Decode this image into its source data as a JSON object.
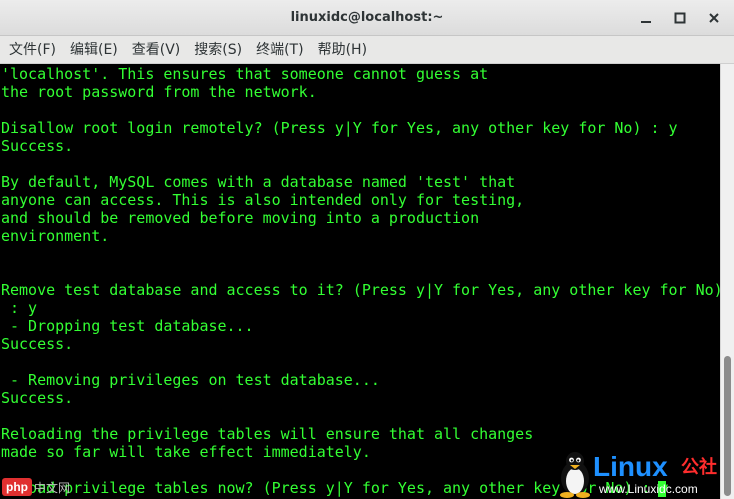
{
  "window": {
    "title": "linuxidc@localhost:~"
  },
  "menu": [
    {
      "label": "文件(F)"
    },
    {
      "label": "编辑(E)"
    },
    {
      "label": "查看(V)"
    },
    {
      "label": "搜索(S)"
    },
    {
      "label": "终端(T)"
    },
    {
      "label": "帮助(H)"
    }
  ],
  "terminal": {
    "text_color": "#33ff33",
    "background": "#000000",
    "lines": [
      "'localhost'. This ensures that someone cannot guess at",
      "the root password from the network.",
      "",
      "Disallow root login remotely? (Press y|Y for Yes, any other key for No) : y",
      "Success.",
      "",
      "By default, MySQL comes with a database named 'test' that",
      "anyone can access. This is also intended only for testing,",
      "and should be removed before moving into a production",
      "environment.",
      "",
      "",
      "Remove test database and access to it? (Press y|Y for Yes, any other key for No)",
      " : y",
      " - Dropping test database...",
      "Success.",
      "",
      " - Removing privileges on test database...",
      "Success.",
      "",
      "Reloading the privilege tables will ensure that all changes",
      "made so far will take effect immediately.",
      "",
      "Reload privilege tables now? (Press y|Y for Yes, any other key for No) : y"
    ]
  },
  "watermarks": {
    "php_badge": "php",
    "php_cn": "中文网",
    "linux_brand": "Linux",
    "linux_cn": "公社",
    "linux_url": "www.Linuxidc.com"
  }
}
